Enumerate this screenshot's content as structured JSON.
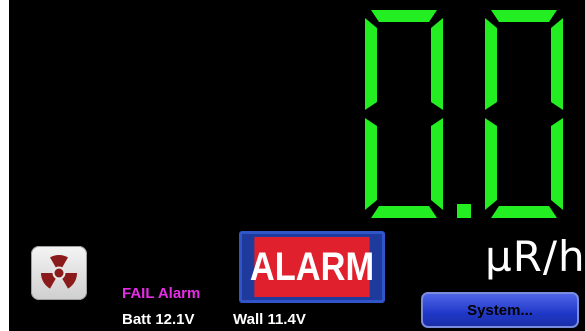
{
  "reading": {
    "value": "0.0",
    "unit": "µR/h",
    "digit_color": "#22ee22"
  },
  "alarm_button": {
    "label": "ALARM",
    "color": "#e0202c"
  },
  "status": {
    "fail_alarm": "FAIL Alarm",
    "fail_color": "#e52de5",
    "battery": "Batt 12.1V",
    "wall": "Wall 11.4V"
  },
  "system_button": {
    "label": "System..."
  },
  "icons": {
    "radiation": "radiation-trefoil-icon"
  }
}
